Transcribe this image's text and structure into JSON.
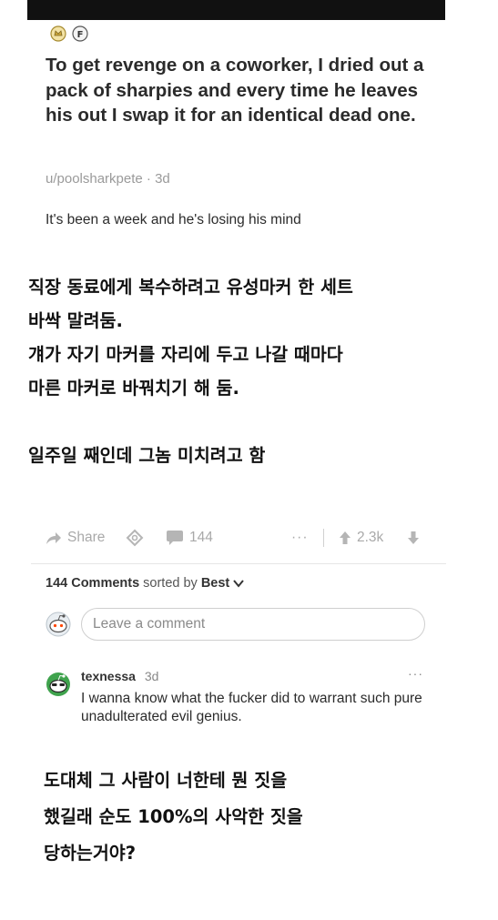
{
  "post": {
    "title": "To get revenge on a coworker, I dried out a pack of sharpies and every time he leaves his out I swap it for an identical dead one.",
    "author": "u/poolsharkpete",
    "age": "3d",
    "meta_separator": "·",
    "body": "It's been a week and he's losing his mind",
    "awards": [
      "gold-award-icon",
      "f-award-icon"
    ]
  },
  "korean_caption": {
    "lines": [
      "직장 동료에게 복수하려고 유성마커 한 세트",
      "바싹 말려둠.",
      "걔가 자기 마커를 자리에 두고 나갈 때마다",
      "마른 마커로 바꿔치기 해 둠."
    ],
    "last_line": "일주일 째인데 그놈 미치려고 함"
  },
  "actions": {
    "share_label": "Share",
    "comment_count": "144",
    "more": "···",
    "score": "2.3k"
  },
  "comments_header": {
    "count_label": "144 Comments",
    "sorted_by": "sorted by",
    "sort_value": "Best"
  },
  "comment_input": {
    "placeholder": "Leave a comment"
  },
  "comment": {
    "author": "texnessa",
    "age": "3d",
    "more": "···",
    "body": "I wanna know what the fucker did to warrant such pure unadulterated evil genius."
  },
  "korean_caption2": {
    "lines": [
      "도대체 그 사람이 너한테 뭔 짓을",
      "했길래 순도 100%의 사악한 짓을",
      "당하는거야?"
    ]
  },
  "colors": {
    "text": "#1c1c1c",
    "muted": "#9a9a9a",
    "avatar_green": "#3fa34d",
    "award_gold": "#d8b84a"
  }
}
